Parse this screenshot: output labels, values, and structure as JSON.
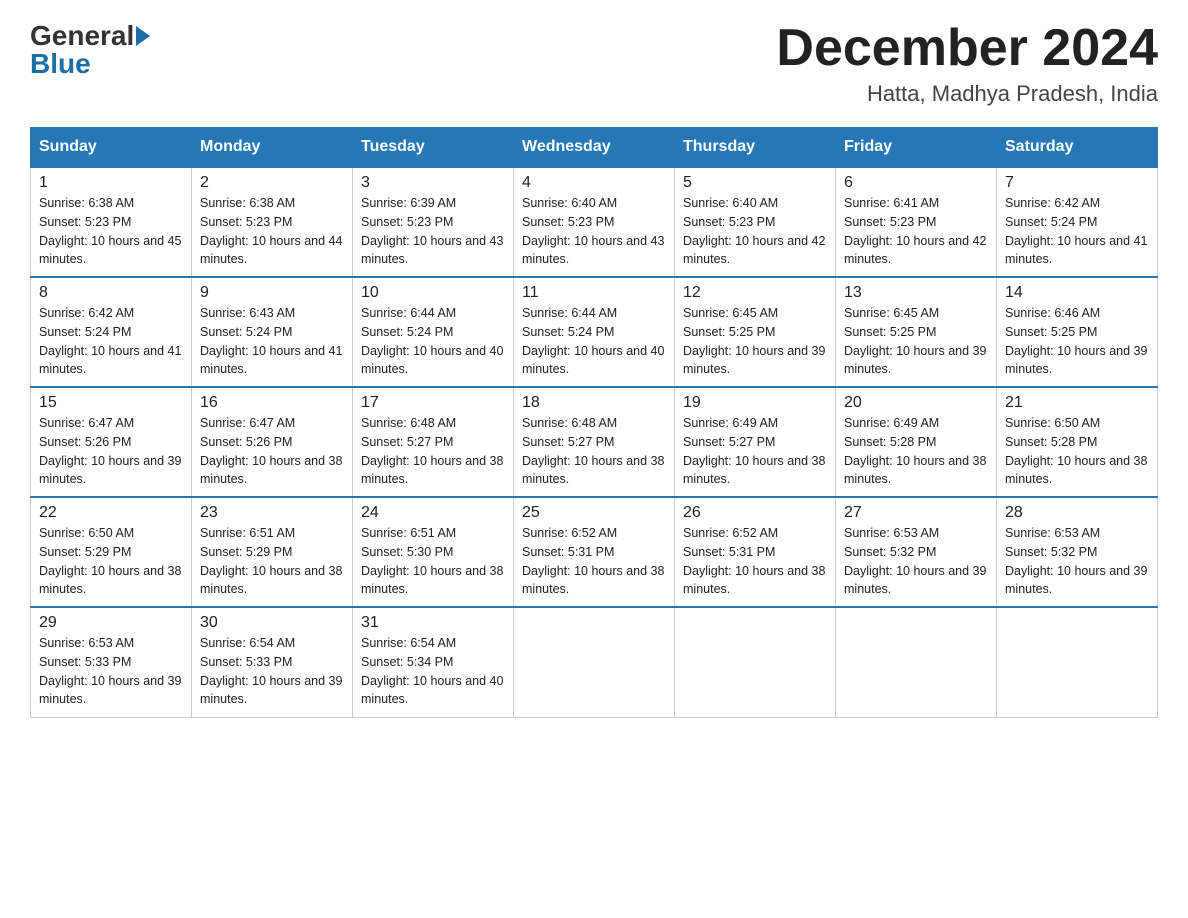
{
  "logo": {
    "general": "General",
    "blue": "Blue"
  },
  "header": {
    "month": "December 2024",
    "location": "Hatta, Madhya Pradesh, India"
  },
  "days_of_week": [
    "Sunday",
    "Monday",
    "Tuesday",
    "Wednesday",
    "Thursday",
    "Friday",
    "Saturday"
  ],
  "weeks": [
    [
      {
        "day": "1",
        "sunrise": "6:38 AM",
        "sunset": "5:23 PM",
        "daylight": "10 hours and 45 minutes."
      },
      {
        "day": "2",
        "sunrise": "6:38 AM",
        "sunset": "5:23 PM",
        "daylight": "10 hours and 44 minutes."
      },
      {
        "day": "3",
        "sunrise": "6:39 AM",
        "sunset": "5:23 PM",
        "daylight": "10 hours and 43 minutes."
      },
      {
        "day": "4",
        "sunrise": "6:40 AM",
        "sunset": "5:23 PM",
        "daylight": "10 hours and 43 minutes."
      },
      {
        "day": "5",
        "sunrise": "6:40 AM",
        "sunset": "5:23 PM",
        "daylight": "10 hours and 42 minutes."
      },
      {
        "day": "6",
        "sunrise": "6:41 AM",
        "sunset": "5:23 PM",
        "daylight": "10 hours and 42 minutes."
      },
      {
        "day": "7",
        "sunrise": "6:42 AM",
        "sunset": "5:24 PM",
        "daylight": "10 hours and 41 minutes."
      }
    ],
    [
      {
        "day": "8",
        "sunrise": "6:42 AM",
        "sunset": "5:24 PM",
        "daylight": "10 hours and 41 minutes."
      },
      {
        "day": "9",
        "sunrise": "6:43 AM",
        "sunset": "5:24 PM",
        "daylight": "10 hours and 41 minutes."
      },
      {
        "day": "10",
        "sunrise": "6:44 AM",
        "sunset": "5:24 PM",
        "daylight": "10 hours and 40 minutes."
      },
      {
        "day": "11",
        "sunrise": "6:44 AM",
        "sunset": "5:24 PM",
        "daylight": "10 hours and 40 minutes."
      },
      {
        "day": "12",
        "sunrise": "6:45 AM",
        "sunset": "5:25 PM",
        "daylight": "10 hours and 39 minutes."
      },
      {
        "day": "13",
        "sunrise": "6:45 AM",
        "sunset": "5:25 PM",
        "daylight": "10 hours and 39 minutes."
      },
      {
        "day": "14",
        "sunrise": "6:46 AM",
        "sunset": "5:25 PM",
        "daylight": "10 hours and 39 minutes."
      }
    ],
    [
      {
        "day": "15",
        "sunrise": "6:47 AM",
        "sunset": "5:26 PM",
        "daylight": "10 hours and 39 minutes."
      },
      {
        "day": "16",
        "sunrise": "6:47 AM",
        "sunset": "5:26 PM",
        "daylight": "10 hours and 38 minutes."
      },
      {
        "day": "17",
        "sunrise": "6:48 AM",
        "sunset": "5:27 PM",
        "daylight": "10 hours and 38 minutes."
      },
      {
        "day": "18",
        "sunrise": "6:48 AM",
        "sunset": "5:27 PM",
        "daylight": "10 hours and 38 minutes."
      },
      {
        "day": "19",
        "sunrise": "6:49 AM",
        "sunset": "5:27 PM",
        "daylight": "10 hours and 38 minutes."
      },
      {
        "day": "20",
        "sunrise": "6:49 AM",
        "sunset": "5:28 PM",
        "daylight": "10 hours and 38 minutes."
      },
      {
        "day": "21",
        "sunrise": "6:50 AM",
        "sunset": "5:28 PM",
        "daylight": "10 hours and 38 minutes."
      }
    ],
    [
      {
        "day": "22",
        "sunrise": "6:50 AM",
        "sunset": "5:29 PM",
        "daylight": "10 hours and 38 minutes."
      },
      {
        "day": "23",
        "sunrise": "6:51 AM",
        "sunset": "5:29 PM",
        "daylight": "10 hours and 38 minutes."
      },
      {
        "day": "24",
        "sunrise": "6:51 AM",
        "sunset": "5:30 PM",
        "daylight": "10 hours and 38 minutes."
      },
      {
        "day": "25",
        "sunrise": "6:52 AM",
        "sunset": "5:31 PM",
        "daylight": "10 hours and 38 minutes."
      },
      {
        "day": "26",
        "sunrise": "6:52 AM",
        "sunset": "5:31 PM",
        "daylight": "10 hours and 38 minutes."
      },
      {
        "day": "27",
        "sunrise": "6:53 AM",
        "sunset": "5:32 PM",
        "daylight": "10 hours and 39 minutes."
      },
      {
        "day": "28",
        "sunrise": "6:53 AM",
        "sunset": "5:32 PM",
        "daylight": "10 hours and 39 minutes."
      }
    ],
    [
      {
        "day": "29",
        "sunrise": "6:53 AM",
        "sunset": "5:33 PM",
        "daylight": "10 hours and 39 minutes."
      },
      {
        "day": "30",
        "sunrise": "6:54 AM",
        "sunset": "5:33 PM",
        "daylight": "10 hours and 39 minutes."
      },
      {
        "day": "31",
        "sunrise": "6:54 AM",
        "sunset": "5:34 PM",
        "daylight": "10 hours and 40 minutes."
      },
      null,
      null,
      null,
      null
    ]
  ]
}
